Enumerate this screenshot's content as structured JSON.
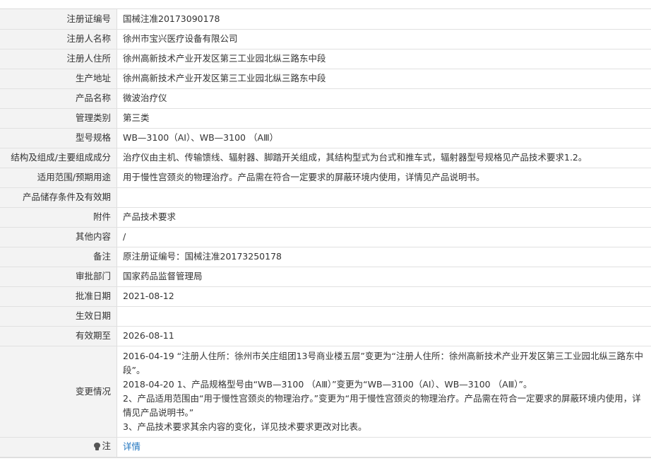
{
  "fields": [
    {
      "label": "注册证编号",
      "value": "国械注准20173090178"
    },
    {
      "label": "注册人名称",
      "value": "徐州市宝兴医疗设备有限公司"
    },
    {
      "label": "注册人住所",
      "value": "徐州高新技术产业开发区第三工业园北纵三路东中段"
    },
    {
      "label": "生产地址",
      "value": "徐州高新技术产业开发区第三工业园北纵三路东中段"
    },
    {
      "label": "产品名称",
      "value": "微波治疗仪"
    },
    {
      "label": "管理类别",
      "value": "第三类"
    },
    {
      "label": "型号规格",
      "value": "WB—3100（AⅠ）、WB—3100 （AⅢ）"
    },
    {
      "label": "结构及组成/主要组成成分",
      "value": "治疗仪由主机、传输馈线、辐射器、脚踏开关组成，其结构型式为台式和推车式，辐射器型号规格见产品技术要求1.2。"
    },
    {
      "label": "适用范围/预期用途",
      "value": "用于慢性宫颈炎的物理治疗。产品需在符合一定要求的屏蔽环境内使用，详情见产品说明书。"
    },
    {
      "label": "产品储存条件及有效期",
      "value": ""
    },
    {
      "label": "附件",
      "value": "产品技术要求"
    },
    {
      "label": "其他内容",
      "value": "/"
    },
    {
      "label": "备注",
      "value": "原注册证编号：国械注准20173250178"
    },
    {
      "label": "审批部门",
      "value": "国家药品监督管理局"
    },
    {
      "label": "批准日期",
      "value": "2021-08-12"
    },
    {
      "label": "生效日期",
      "value": ""
    },
    {
      "label": "有效期至",
      "value": "2026-08-11"
    }
  ],
  "change": {
    "label": "变更情况",
    "lines": [
      "2016-04-19 “注册人住所：徐州市关庄组团13号商业楼五层”变更为“注册人住所：徐州高新技术产业开发区第三工业园北纵三路东中段”。",
      "2018-04-20 1、产品规格型号由“WB—3100 （AⅢ）”变更为“WB—3100（AⅠ）、WB—3100 （AⅢ）”。",
      "2、产品适用范围由“用于慢性宫颈炎的物理治疗。”变更为“用于慢性宫颈炎的物理治疗。产品需在符合一定要求的屏蔽环境内使用，详情见产品说明书。”",
      "3、产品技术要求其余内容的变化，详见技术要求更改对比表。"
    ]
  },
  "note": {
    "label": "注",
    "icon": "bulb-icon",
    "link_text": "详情"
  },
  "colors": {
    "label_bg": "#f3f3f3",
    "border": "#e1e1e1",
    "link": "#1e73be"
  }
}
